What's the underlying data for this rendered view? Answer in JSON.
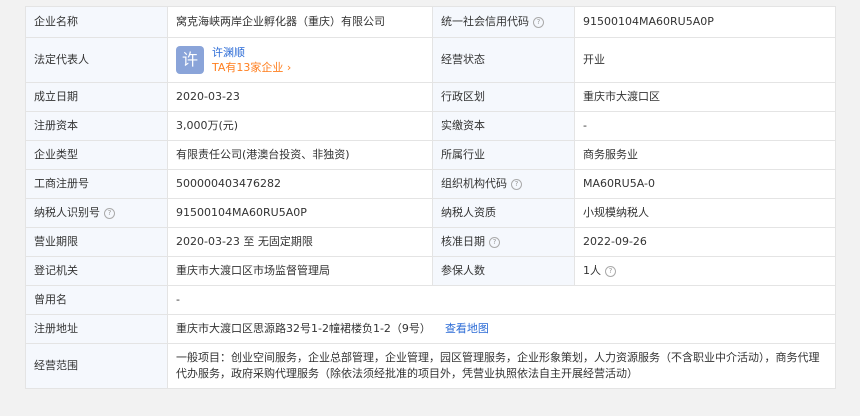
{
  "rows": [
    {
      "k1": "企业名称",
      "v1": "窝克海峡两岸企业孵化器（重庆）有限公司",
      "k2": "统一社会信用代码",
      "v2": "91500104MA60RU5A0P"
    },
    {
      "k1": "法定代表人",
      "rep_avatar": "许",
      "rep_name": "许渊顺",
      "rep_count": "TA有13家企业",
      "k2": "经营状态",
      "v2": "开业"
    },
    {
      "k1": "成立日期",
      "v1": "2020-03-23",
      "k2": "行政区划",
      "v2": "重庆市大渡口区"
    },
    {
      "k1": "注册资本",
      "v1": "3,000万(元)",
      "k2": "实缴资本",
      "v2": "-"
    },
    {
      "k1": "企业类型",
      "v1": "有限责任公司(港澳台投资、非独资)",
      "k2": "所属行业",
      "v2": "商务服务业"
    },
    {
      "k1": "工商注册号",
      "v1": "500000403476282",
      "k2": "组织机构代码",
      "v2": "MA60RU5A-0"
    },
    {
      "k1": "纳税人识别号",
      "v1": "91500104MA60RU5A0P",
      "k2": "纳税人资质",
      "v2": "小规模纳税人"
    },
    {
      "k1": "营业期限",
      "v1": "2020-03-23 至 无固定期限",
      "k2": "核准日期",
      "v2": "2022-09-26"
    },
    {
      "k1": "登记机关",
      "v1": "重庆市大渡口区市场监督管理局",
      "k2": "参保人数",
      "v2": "1人"
    },
    {
      "k1": "曾用名",
      "v1": "-"
    },
    {
      "k1": "注册地址",
      "v1": "重庆市大渡口区思源路32号1-2幢裙楼负1-2（9号）",
      "link": "查看地图"
    },
    {
      "k1": "经营范围",
      "v1": "一般项目：创业空间服务，企业总部管理，企业管理，园区管理服务，企业形象策划，人力资源服务（不含职业中介活动），商务代理代办服务，政府采购代理服务（除依法须经批准的项目外，凭营业执照依法自主开展经营活动）"
    }
  ],
  "icons": {
    "help": "question-circle-icon",
    "chevron": "chevron-right-icon"
  },
  "colors": {
    "label_bg": "#f5f8fd",
    "link": "#2b6bd6",
    "accent": "#ff7f1f",
    "border": "#e4e4e4"
  }
}
